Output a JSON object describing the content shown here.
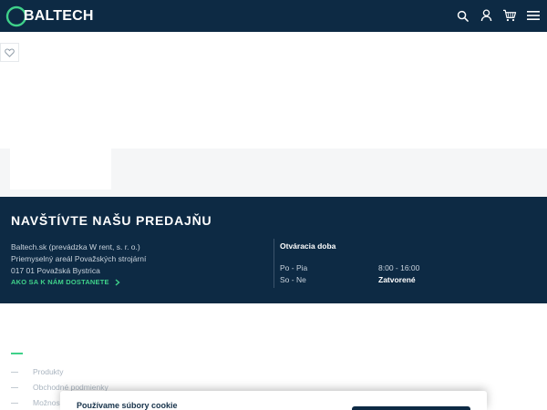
{
  "header": {
    "brand": "BALTECH",
    "logo_letter": "B",
    "icons": [
      "search-icon",
      "user-icon",
      "cart-icon",
      "menu-icon"
    ]
  },
  "product": {
    "favorite_icon": "heart-icon"
  },
  "visit": {
    "title": "NAVŠTÍVTE NAŠU PREDAJŇU",
    "address_lines": [
      "Baltech.sk (prevádzka W rent, s. r. o.)",
      "Priemyselný areál Považských strojární",
      "017 01 Považská Bystrica"
    ],
    "directions_label": "AKO SA K NÁM DOSTANETE",
    "hours_title": "Otváracia doba",
    "hours": [
      {
        "days": "Po - Pia",
        "time": "8:00 - 16:00"
      },
      {
        "days": "So - Ne",
        "time": "Zatvorené"
      }
    ]
  },
  "footer_links": [
    "Produkty",
    "Obchodné podmienky",
    "Možnosti"
  ],
  "cookie": {
    "title": "Používame súbory cookie"
  },
  "colors": {
    "navy": "#0d2a44",
    "accent": "#3fd18a",
    "band": "#f5f6f7"
  }
}
